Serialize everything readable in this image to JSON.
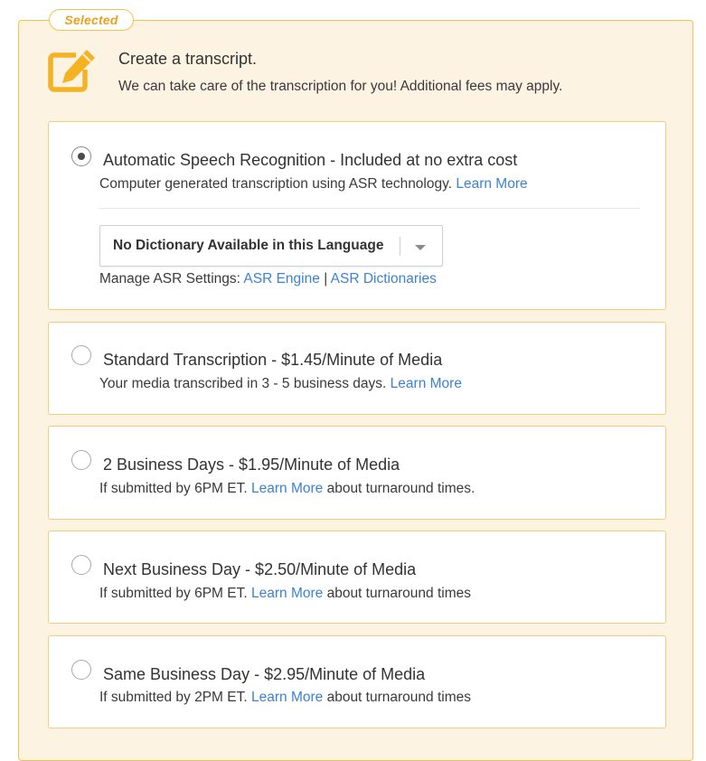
{
  "badge": "Selected",
  "header": {
    "title": "Create a transcript.",
    "subtitle": "We can take care of the transcription for you! Additional fees may apply."
  },
  "colors": {
    "accent": "#f5b324",
    "panel_bg": "#fdf3e2",
    "link": "#3c82d4"
  },
  "icons": {
    "header": "edit-icon"
  },
  "asr": {
    "selected": true,
    "title": "Automatic Speech Recognition - Included at no extra cost",
    "desc": "Computer generated transcription using ASR technology.",
    "learn_more": "Learn More",
    "dictionary": "No Dictionary Available in this Language",
    "manage_label": "Manage ASR Settings:",
    "engine_link": "ASR Engine",
    "separator": "|",
    "dictionaries_link": "ASR Dictionaries"
  },
  "standard": {
    "selected": false,
    "title": "Standard Transcription - $1.45/Minute of Media",
    "desc": "Your media transcribed in 3 - 5 business days.",
    "learn_more": "Learn More"
  },
  "two_day": {
    "selected": false,
    "title": "2 Business Days - $1.95/Minute of Media",
    "desc_pre": "If submitted by 6PM ET.",
    "learn_more": "Learn More",
    "desc_post": "about turnaround times."
  },
  "next_day": {
    "selected": false,
    "title": "Next Business Day - $2.50/Minute of Media",
    "desc_pre": "If submitted by 6PM ET.",
    "learn_more": "Learn More",
    "desc_post": "about turnaround times"
  },
  "same_day": {
    "selected": false,
    "title": "Same Business Day - $2.95/Minute of Media",
    "desc_pre": "If submitted by 2PM ET.",
    "learn_more": "Learn More",
    "desc_post": "about turnaround times"
  }
}
